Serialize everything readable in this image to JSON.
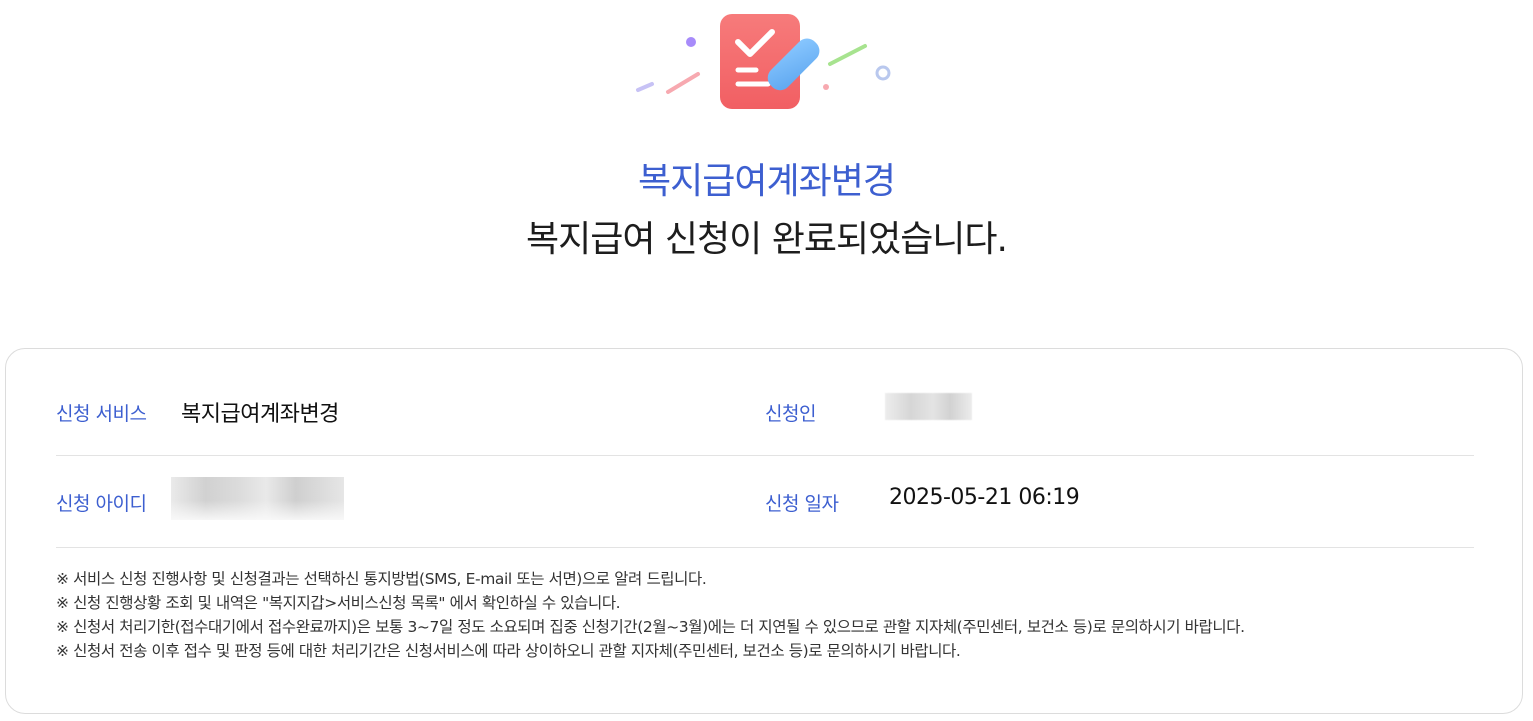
{
  "header": {
    "title": "복지급여계좌변경",
    "subtitle": "복지급여 신청이 완료되었습니다."
  },
  "summary": {
    "service_label": "신청 서비스",
    "service_value": "복지급여계좌변경",
    "applicant_label": "신청인",
    "applicant_id_label": "신청 아이디",
    "date_label": "신청 일자",
    "date_value": "2025-05-21 06:19"
  },
  "notes": [
    "※ 서비스 신청 진행사항 및 신청결과는 선택하신 통지방법(SMS, E-mail 또는 서면)으로 알려 드립니다.",
    "※ 신청 진행상황 조회 및 내역은 \"복지지갑>서비스신청 목록\" 에서 확인하실 수 있습니다.",
    "※ 신청서 처리기한(접수대기에서 접수완료까지)은 보통 3~7일 정도 소요되며 집중 신청기간(2월~3월)에는 더 지연될 수 있으므로 관할 지자체(주민센터, 보건소 등)로 문의하시기 바랍니다.",
    "※ 신청서 전송 이후 접수 및 판정 등에 대한 처리기간은 신청서비스에 따라 상이하오니 관할 지자체(주민센터, 보건소 등)로 문의하시기 바랍니다."
  ],
  "icons": {
    "hero": "application-form-check-pencil-icon"
  },
  "colors": {
    "accent": "#3d5fd0",
    "icon_red": "#f26b6b",
    "icon_blue": "#6fb3f5"
  }
}
